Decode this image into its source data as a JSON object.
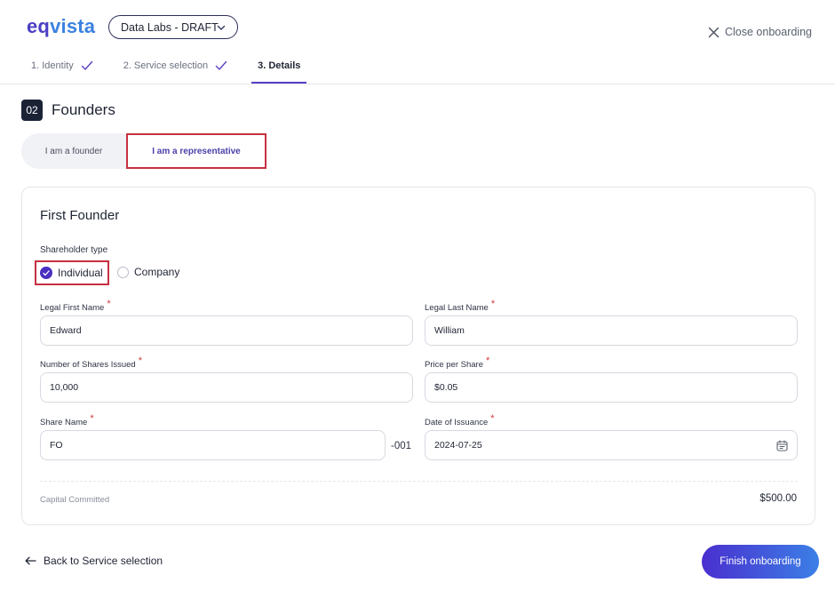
{
  "brand": {
    "logo_part1": "eq",
    "logo_part2": "vista"
  },
  "header": {
    "company_select": "Data Labs - DRAFT",
    "close_label": "Close onboarding"
  },
  "steps": [
    {
      "label": "1. Identity",
      "state": "done"
    },
    {
      "label": "2. Service selection",
      "state": "done"
    },
    {
      "label": "3. Details",
      "state": "active"
    }
  ],
  "section": {
    "number": "02",
    "title": "Founders"
  },
  "segment": {
    "options": [
      "I am a founder",
      "I am a representative"
    ],
    "selected": "I am a representative"
  },
  "founder_card": {
    "title": "First Founder",
    "shareholder_type_label": "Shareholder type",
    "shareholder_options": [
      "Individual",
      "Company"
    ],
    "shareholder_selected": "Individual",
    "fields": {
      "first_name": {
        "label": "Legal First Name",
        "value": "Edward"
      },
      "last_name": {
        "label": "Legal Last Name",
        "value": "William"
      },
      "shares": {
        "label": "Number of Shares Issued",
        "value": "10,000"
      },
      "price": {
        "label": "Price per Share",
        "value": "$0.05"
      },
      "share_name": {
        "label": "Share Name",
        "value": "FO",
        "suffix": "-001"
      },
      "issuance_date": {
        "label": "Date of Issuance",
        "value": "2024-07-25"
      }
    },
    "required_mark": "*",
    "capital_label": "Capital Committed",
    "capital_value": "$500.00"
  },
  "footer": {
    "back_label": "Back to Service selection",
    "finish_label": "Finish onboarding"
  },
  "colors": {
    "accent": "#4a2fbf",
    "highlight_border": "#c53040",
    "finish_gradient_start": "#4a2fcf",
    "finish_gradient_end": "#3b7fe6"
  }
}
